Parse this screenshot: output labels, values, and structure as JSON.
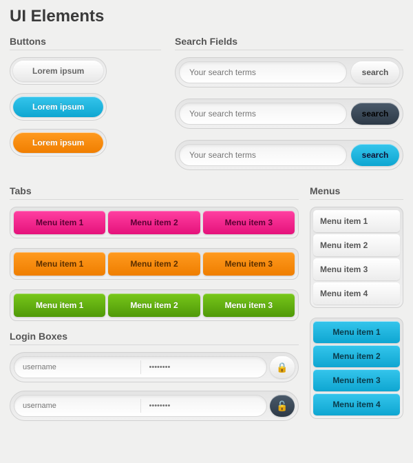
{
  "title": "UI Elements",
  "sections": {
    "buttons": "Buttons",
    "search": "Search Fields",
    "tabs": "Tabs",
    "menus": "Menus",
    "login": "Login Boxes"
  },
  "buttons": {
    "white": "Lorem ipsum",
    "blue": "Lorem ipsum",
    "orange": "Lorem ipsum"
  },
  "search": {
    "placeholder": "Your search terms",
    "label": "search"
  },
  "tabs": {
    "items": [
      "Menu item 1",
      "Menu item 2",
      "Menu item 3"
    ]
  },
  "vmenu": {
    "items": [
      "Menu item 1",
      "Menu item 2",
      "Menu item 3",
      "Menu item 4"
    ]
  },
  "login": {
    "user_ph": "username",
    "pass_ph": "••••••••"
  }
}
